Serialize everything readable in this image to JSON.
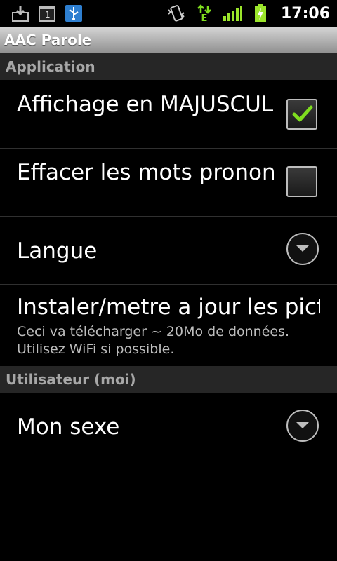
{
  "status_bar": {
    "time": "17:06",
    "notification_count": "1",
    "network_type": "E",
    "icons": [
      "download-icon",
      "calendar-icon",
      "usb-icon",
      "vibrate-icon",
      "data-transfer-icon",
      "signal-icon",
      "battery-charging-icon"
    ]
  },
  "app": {
    "title": "AAC Parole"
  },
  "sections": [
    {
      "header": "Application",
      "items": [
        {
          "title": "Affichage en MAJUSCULES",
          "type": "checkbox",
          "checked": true
        },
        {
          "title": "Effacer les mots prononcés",
          "type": "checkbox",
          "checked": false
        },
        {
          "title": "Langue",
          "type": "list"
        },
        {
          "title": "Instaler/metre a jour les pictos",
          "summary": "Ceci va télécharger ~ 20Mo de données. Utilisez WiFi si possible.",
          "type": "action"
        }
      ]
    },
    {
      "header": "Utilisateur (moi)",
      "items": [
        {
          "title": "Mon sexe",
          "type": "list"
        }
      ]
    }
  ],
  "colors": {
    "accent_check": "#7fdd1f",
    "signal": "#9be52b",
    "header_text": "#a7a7a7"
  }
}
